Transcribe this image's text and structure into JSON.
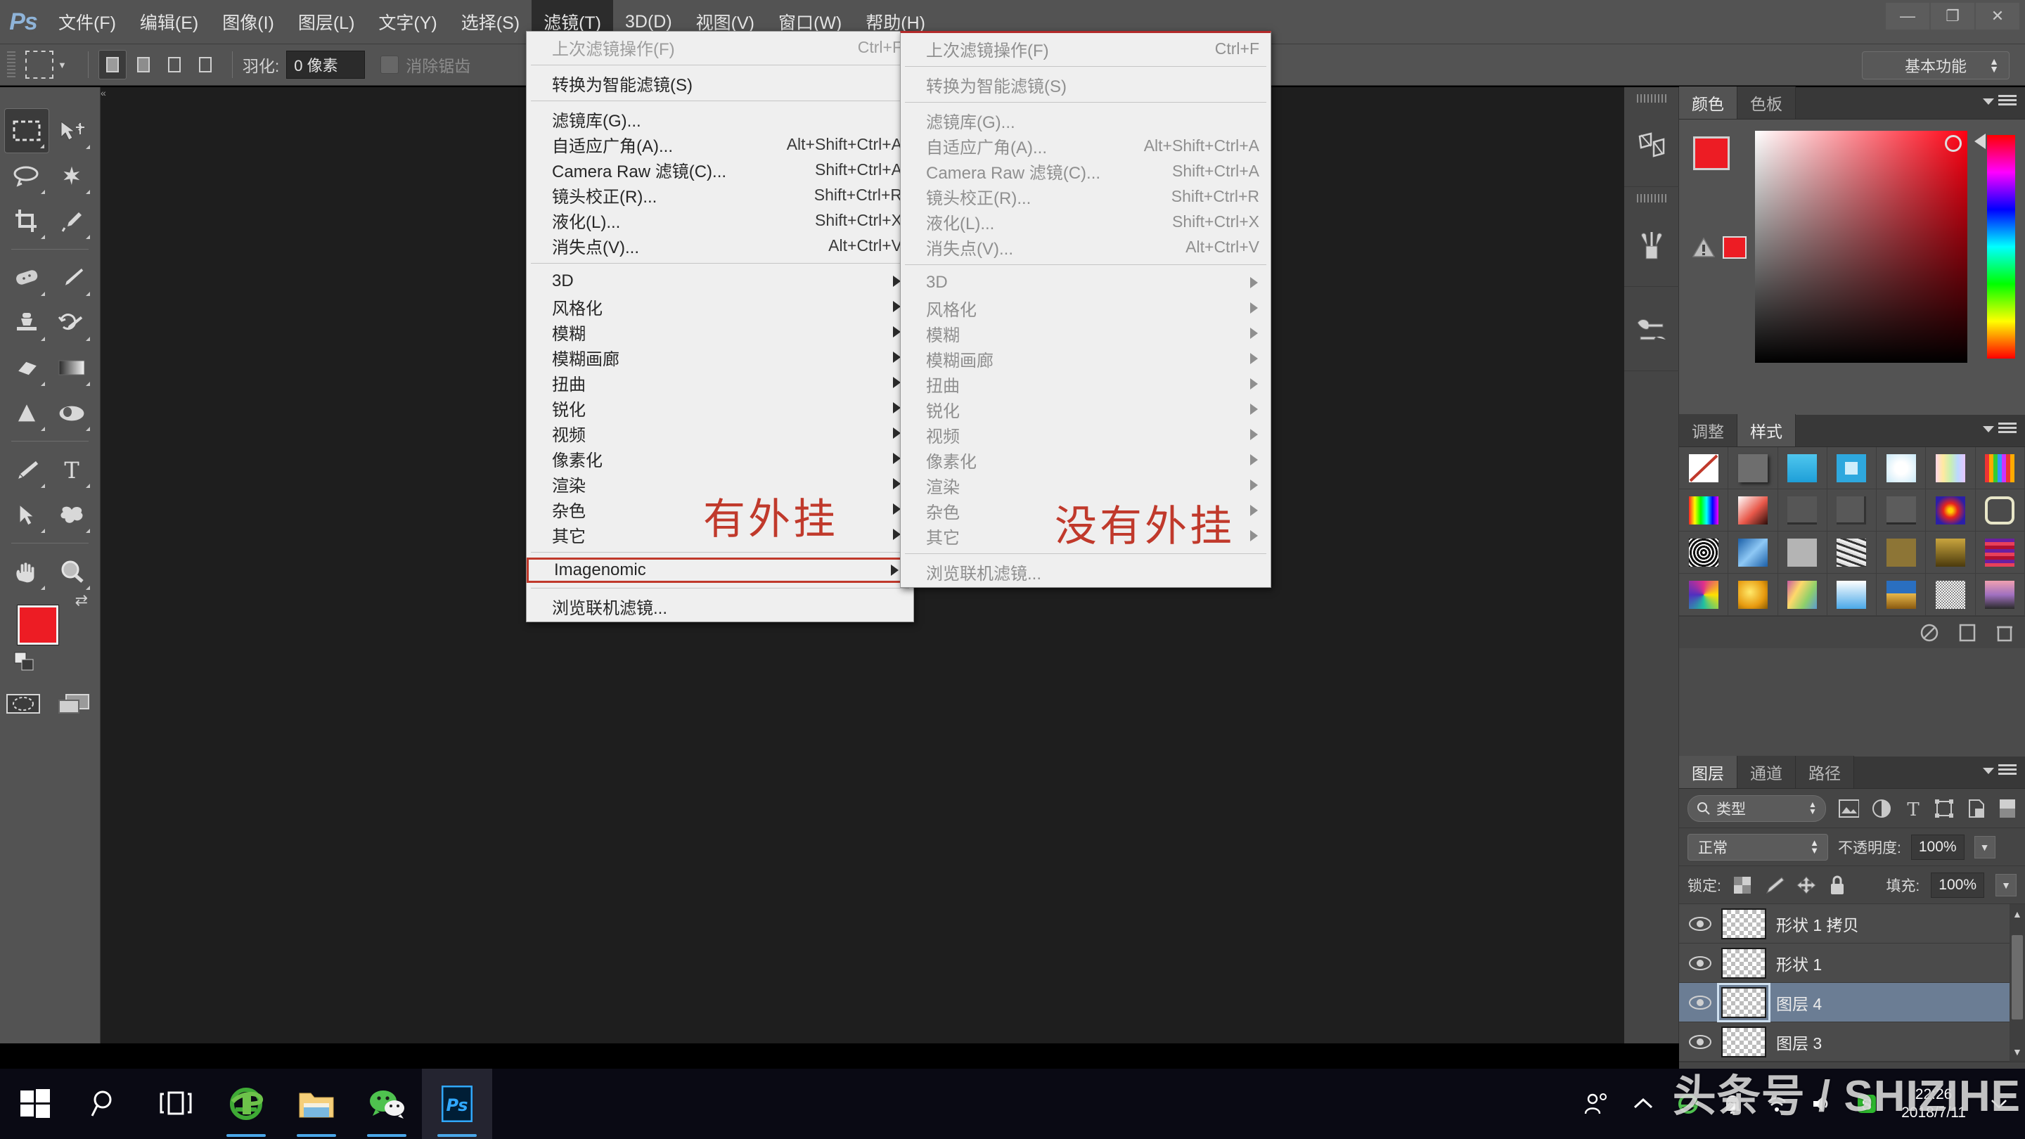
{
  "app": {
    "logo": "Ps",
    "workspace": "基本功能"
  },
  "menubar": {
    "items": [
      {
        "label": "文件(F)",
        "active": false
      },
      {
        "label": "编辑(E)",
        "active": false
      },
      {
        "label": "图像(I)",
        "active": false
      },
      {
        "label": "图层(L)",
        "active": false
      },
      {
        "label": "文字(Y)",
        "active": false
      },
      {
        "label": "选择(S)",
        "active": false
      },
      {
        "label": "滤镜(T)",
        "active": true
      },
      {
        "label": "3D(D)",
        "active": false
      },
      {
        "label": "视图(V)",
        "active": false
      },
      {
        "label": "窗口(W)",
        "active": false
      },
      {
        "label": "帮助(H)",
        "active": false
      }
    ],
    "window_controls": {
      "minimize": "—",
      "restore": "❐",
      "close": "✕"
    }
  },
  "options_bar": {
    "feather_label": "羽化:",
    "feather_value": "0 像素",
    "antialias_label": "消除锯齿"
  },
  "filter_menu_left": {
    "title": "有外挂",
    "items": [
      {
        "label": "上次滤镜操作(F)",
        "accel": "Ctrl+F",
        "state": "disabled",
        "submenu": false
      },
      {
        "sep": true
      },
      {
        "label": "转换为智能滤镜(S)",
        "accel": "",
        "state": "normal",
        "submenu": false
      },
      {
        "sep": true
      },
      {
        "label": "滤镜库(G)...",
        "accel": "",
        "state": "normal",
        "submenu": false
      },
      {
        "label": "自适应广角(A)...",
        "accel": "Alt+Shift+Ctrl+A",
        "state": "normal",
        "submenu": false
      },
      {
        "label": "Camera Raw 滤镜(C)...",
        "accel": "Shift+Ctrl+A",
        "state": "normal",
        "submenu": false
      },
      {
        "label": "镜头校正(R)...",
        "accel": "Shift+Ctrl+R",
        "state": "normal",
        "submenu": false
      },
      {
        "label": "液化(L)...",
        "accel": "Shift+Ctrl+X",
        "state": "normal",
        "submenu": false
      },
      {
        "label": "消失点(V)...",
        "accel": "Alt+Ctrl+V",
        "state": "normal",
        "submenu": false
      },
      {
        "sep": true
      },
      {
        "label": "3D",
        "accel": "",
        "state": "normal",
        "submenu": true
      },
      {
        "label": "风格化",
        "accel": "",
        "state": "normal",
        "submenu": true
      },
      {
        "label": "模糊",
        "accel": "",
        "state": "normal",
        "submenu": true
      },
      {
        "label": "模糊画廊",
        "accel": "",
        "state": "normal",
        "submenu": true
      },
      {
        "label": "扭曲",
        "accel": "",
        "state": "normal",
        "submenu": true
      },
      {
        "label": "锐化",
        "accel": "",
        "state": "normal",
        "submenu": true
      },
      {
        "label": "视频",
        "accel": "",
        "state": "normal",
        "submenu": true
      },
      {
        "label": "像素化",
        "accel": "",
        "state": "normal",
        "submenu": true
      },
      {
        "label": "渲染",
        "accel": "",
        "state": "normal",
        "submenu": true
      },
      {
        "label": "杂色",
        "accel": "",
        "state": "normal",
        "submenu": true
      },
      {
        "label": "其它",
        "accel": "",
        "state": "normal",
        "submenu": true
      },
      {
        "sep": true
      },
      {
        "label": "Imagenomic",
        "accel": "",
        "state": "highlight",
        "submenu": true
      },
      {
        "sep": true
      },
      {
        "label": "浏览联机滤镜...",
        "accel": "",
        "state": "normal",
        "submenu": false
      }
    ]
  },
  "filter_menu_right": {
    "title": "没有外挂",
    "items": [
      {
        "label": "上次滤镜操作(F)",
        "accel": "Ctrl+F",
        "state": "grey",
        "submenu": false
      },
      {
        "sep": true
      },
      {
        "label": "转换为智能滤镜(S)",
        "accel": "",
        "state": "grey",
        "submenu": false
      },
      {
        "sep": true
      },
      {
        "label": "滤镜库(G)...",
        "accel": "",
        "state": "grey",
        "submenu": false
      },
      {
        "label": "自适应广角(A)...",
        "accel": "Alt+Shift+Ctrl+A",
        "state": "grey",
        "submenu": false
      },
      {
        "label": "Camera Raw 滤镜(C)...",
        "accel": "Shift+Ctrl+A",
        "state": "grey",
        "submenu": false
      },
      {
        "label": "镜头校正(R)...",
        "accel": "Shift+Ctrl+R",
        "state": "grey",
        "submenu": false
      },
      {
        "label": "液化(L)...",
        "accel": "Shift+Ctrl+X",
        "state": "grey",
        "submenu": false
      },
      {
        "label": "消失点(V)...",
        "accel": "Alt+Ctrl+V",
        "state": "grey",
        "submenu": false
      },
      {
        "sep": true
      },
      {
        "label": "3D",
        "accel": "",
        "state": "grey",
        "submenu": true
      },
      {
        "label": "风格化",
        "accel": "",
        "state": "grey",
        "submenu": true
      },
      {
        "label": "模糊",
        "accel": "",
        "state": "grey",
        "submenu": true
      },
      {
        "label": "模糊画廊",
        "accel": "",
        "state": "grey",
        "submenu": true
      },
      {
        "label": "扭曲",
        "accel": "",
        "state": "grey",
        "submenu": true
      },
      {
        "label": "锐化",
        "accel": "",
        "state": "grey",
        "submenu": true
      },
      {
        "label": "视频",
        "accel": "",
        "state": "grey",
        "submenu": true
      },
      {
        "label": "像素化",
        "accel": "",
        "state": "grey",
        "submenu": true
      },
      {
        "label": "渲染",
        "accel": "",
        "state": "grey",
        "submenu": true
      },
      {
        "label": "杂色",
        "accel": "",
        "state": "grey",
        "submenu": true
      },
      {
        "label": "其它",
        "accel": "",
        "state": "grey",
        "submenu": true
      },
      {
        "sep": true
      },
      {
        "label": "浏览联机滤镜...",
        "accel": "",
        "state": "grey",
        "submenu": false
      }
    ]
  },
  "color_panel": {
    "tabs": [
      {
        "label": "颜色",
        "on": true
      },
      {
        "label": "色板",
        "on": false
      }
    ],
    "foreground": "#ed1c24",
    "background": "#ffffff",
    "out_of_gamut_swatch": "#ed1c24"
  },
  "styles_panel": {
    "tabs": [
      {
        "label": "调整",
        "on": false
      },
      {
        "label": "样式",
        "on": true
      }
    ],
    "swatches": [
      "none",
      "#6e6e6e",
      "#38b6e8",
      "#2ea8de",
      "#eaf6fd",
      "rainbow-soft",
      "rainbow-bars",
      "rainbow-full",
      "#d94a3a",
      "#5a5a5a",
      "#565656",
      "#5c5c5c",
      "#e03020",
      "#e8e6c8",
      "#2a2a2a",
      "#4a8fd0",
      "#b4b4b4",
      "#777777",
      "#8d7536",
      "#8a6a1e",
      "#7b2a55",
      "#8a3a7a",
      "#e8a41c",
      "#6fa05a",
      "#6cb6ee",
      "#3a7fc0",
      "#d8d8d8",
      "#b07090"
    ]
  },
  "layers_panel": {
    "tabs": [
      {
        "label": "图层",
        "on": true
      },
      {
        "label": "通道",
        "on": false
      },
      {
        "label": "路径",
        "on": false
      }
    ],
    "filter_label": "类型",
    "blend_mode": "正常",
    "opacity_label": "不透明度:",
    "opacity_value": "100%",
    "lock_label": "锁定:",
    "fill_label": "填充:",
    "fill_value": "100%",
    "layers": [
      {
        "name": "形状 1 拷贝",
        "visible": true,
        "selected": false
      },
      {
        "name": "形状 1",
        "visible": true,
        "selected": false
      },
      {
        "name": "图层 4",
        "visible": true,
        "selected": true
      },
      {
        "name": "图层 3",
        "visible": true,
        "selected": false
      }
    ]
  },
  "taskbar": {
    "apps": [
      {
        "name": "start-button"
      },
      {
        "name": "search-button"
      },
      {
        "name": "task-view-button"
      },
      {
        "name": "internet-explorer"
      },
      {
        "name": "file-explorer"
      },
      {
        "name": "wechat"
      },
      {
        "name": "photoshop"
      }
    ],
    "clock_time": "22:26",
    "clock_date": "2018/7/11"
  },
  "watermark": {
    "text": "头条号 / SHIZIHE"
  }
}
